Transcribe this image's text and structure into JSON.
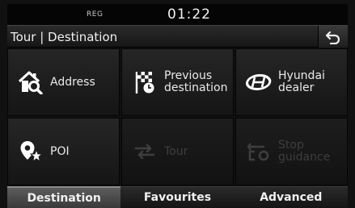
{
  "status": {
    "indicator": "REG",
    "time": "01:22"
  },
  "header": {
    "title": "Tour | Destination",
    "back_icon": "back-arrow-icon"
  },
  "menu": {
    "address": {
      "label": "Address",
      "icon": "home-search-icon"
    },
    "previous_destination": {
      "label_line1": "Previous",
      "label_line2": "destination",
      "icon": "flag-clock-icon"
    },
    "hyundai_dealer": {
      "label_line1": "Hyundai",
      "label_line2": "dealer",
      "icon": "hyundai-logo-icon"
    },
    "poi": {
      "label": "POI",
      "icon": "poi-pin-star-icon"
    },
    "tour": {
      "label": "Tour",
      "icon": "tour-arrows-icon",
      "enabled": false
    },
    "stop_guidance": {
      "label_line1": "Stop",
      "label_line2": "guidance",
      "icon": "stop-guidance-icon",
      "enabled": false
    }
  },
  "tabs": [
    {
      "label": "Destination",
      "active": true
    },
    {
      "label": "Favourites",
      "active": false
    },
    {
      "label": "Advanced",
      "active": false
    }
  ],
  "colors": {
    "background": "#111111",
    "text": "#eaeaea",
    "disabled_text": "#3e3e3e",
    "active_tab": "#4a4a4a"
  }
}
